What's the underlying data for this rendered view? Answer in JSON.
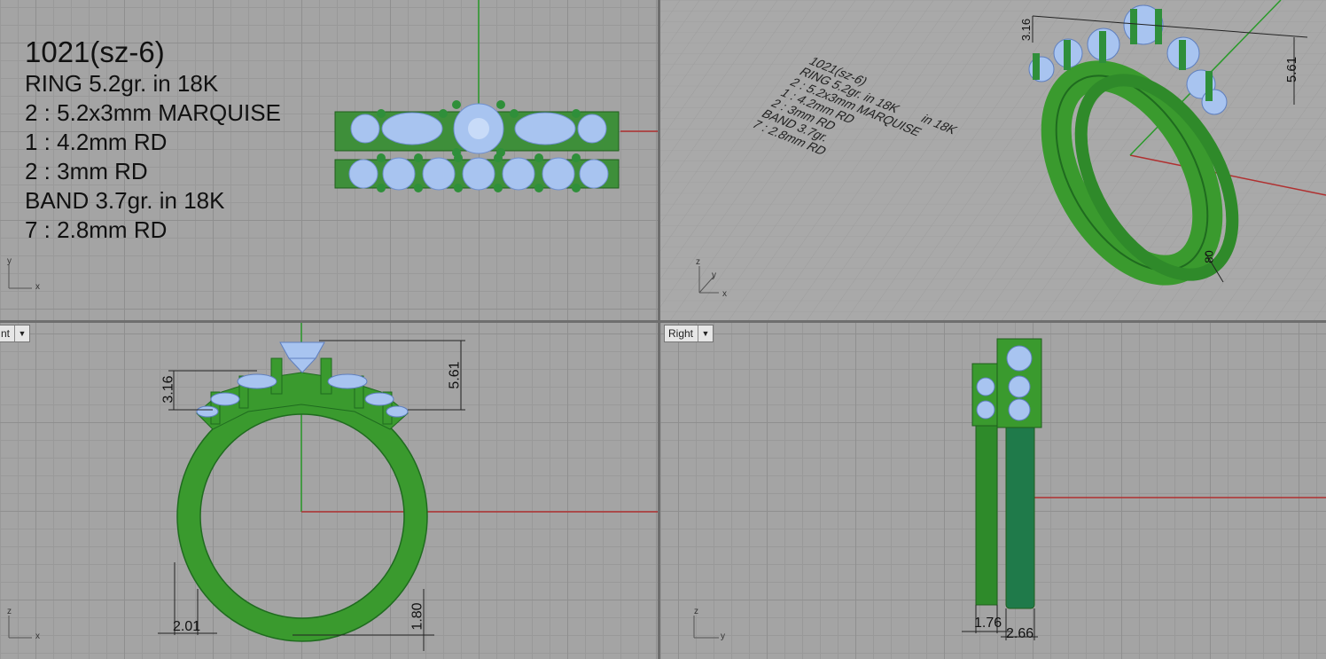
{
  "top_view": {
    "notes": [
      "1021(sz-6)",
      "RING 5.2gr.  in 18K",
      "2 : 5.2x3mm MARQUISE",
      "1 : 4.2mm RD",
      "2 : 3mm RD",
      "BAND 3.7gr.  in 18K",
      "7 : 2.8mm RD"
    ],
    "axis_y": "y",
    "axis_x": "x"
  },
  "perspective_view": {
    "notes": [
      "1021(sz-6)",
      "RING 5.2gr.  in 18K",
      "2 : 5.2x3mm MARQUISE",
      "1 : 4.2mm RD",
      "2 : 3mm RD",
      "BAND 3.7gr.",
      "7 : 2.8mm RD"
    ],
    "notes_suffix": "in 18K",
    "dims": [
      "3.16",
      "5.61",
      "80"
    ],
    "axis_z": "z",
    "axis_y": "y",
    "axis_x": "x"
  },
  "front_view": {
    "tab_label": "nt",
    "dims": [
      "3.16",
      "5.61",
      "2.01",
      "1.80"
    ],
    "axis_z": "z",
    "axis_x": "x"
  },
  "right_view": {
    "tab_label": "Right",
    "dims": [
      "1.76",
      "2.66"
    ],
    "axis_z": "z",
    "axis_y": "y"
  },
  "colors": {
    "background": "#a4a4a4",
    "metal": "#3a9a2e",
    "gem": "#a8c4f0",
    "axis_x": "#b03030",
    "axis_y": "#2a9a2a"
  }
}
